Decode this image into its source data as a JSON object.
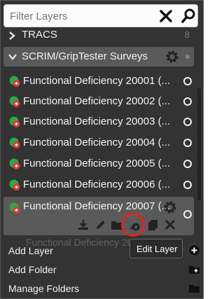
{
  "search": {
    "placeholder": "Filter Layers"
  },
  "groups": [
    {
      "label": "TRACS",
      "count": "8"
    },
    {
      "label": "SCRIM/GripTester Surveys"
    }
  ],
  "layers": [
    {
      "name": "Functional Deficiency 20001 (..."
    },
    {
      "name": "Functional Deficiency 20002 (..."
    },
    {
      "name": "Functional Deficiency 20003 (..."
    },
    {
      "name": "Functional Deficiency 20004 (..."
    },
    {
      "name": "Functional Deficiency 20005 (..."
    },
    {
      "name": "Functional Deficiency 20006 (..."
    }
  ],
  "selected_layer": {
    "name": "Functional Deficiency 20007 (..."
  },
  "tooltip": "Edit Layer",
  "menu": [
    {
      "label": "Add Layer",
      "icon": "plus-circle-icon"
    },
    {
      "label": "Add Folder",
      "icon": "folder-add-icon"
    },
    {
      "label": "Manage Folders",
      "icon": "folder-icon"
    }
  ],
  "colors": {
    "panel": "#333333",
    "selected": "#5a5a5a",
    "highlight": "#e0261f",
    "layer_icon_green": "#2aa84a",
    "layer_icon_red": "#e03a2f"
  }
}
